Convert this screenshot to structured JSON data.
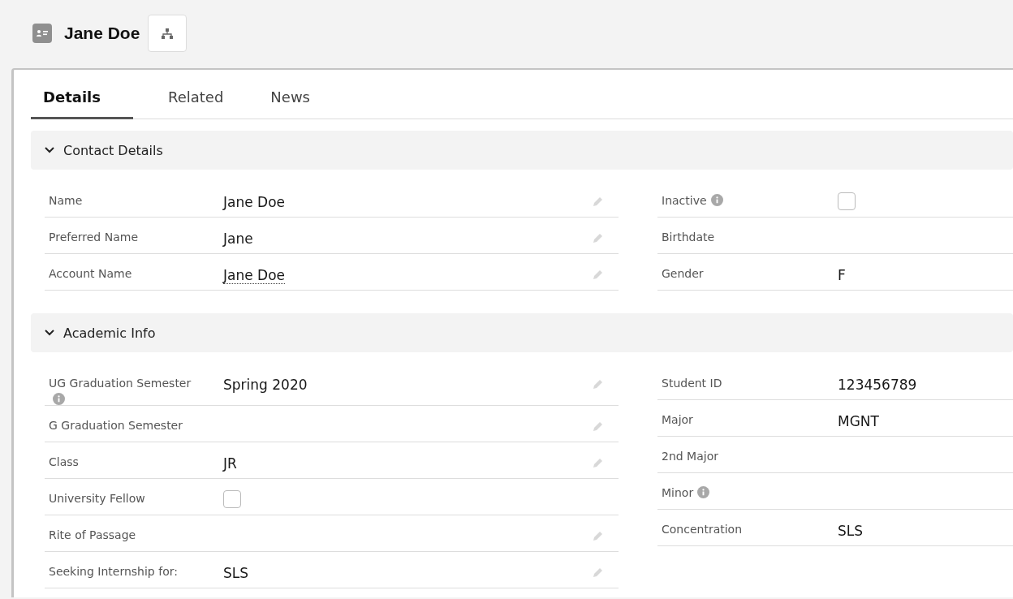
{
  "header": {
    "title": "Jane Doe"
  },
  "tabs": [
    {
      "label": "Details",
      "selected": true
    },
    {
      "label": "Related",
      "selected": false
    },
    {
      "label": "News",
      "selected": false
    }
  ],
  "sections": [
    {
      "title": "Contact Details",
      "expanded": true,
      "left": [
        {
          "label": "Name",
          "kind": "text",
          "value": "Jane Doe",
          "editable": true
        },
        {
          "label": "Preferred Name",
          "kind": "text",
          "value": "Jane",
          "editable": true
        },
        {
          "label": "Account Name",
          "kind": "link",
          "value": "Jane Doe",
          "editable": true
        }
      ],
      "right": [
        {
          "label": "Inactive",
          "info": true,
          "kind": "checkbox",
          "checked": false
        },
        {
          "label": "Birthdate",
          "kind": "text"
        },
        {
          "label": "Gender",
          "kind": "text",
          "value": "F"
        }
      ]
    },
    {
      "title": "Academic Info",
      "expanded": true,
      "left": [
        {
          "label": "UG Graduation Semester",
          "info": true,
          "kind": "text",
          "value": "Spring 2020",
          "editable": true
        },
        {
          "label": "G Graduation Semester",
          "kind": "text",
          "editable": true
        },
        {
          "label": "Class",
          "kind": "text",
          "value": "JR",
          "editable": true
        },
        {
          "label": "University Fellow",
          "kind": "checkbox",
          "checked": false
        },
        {
          "label": "Rite of Passage",
          "kind": "text",
          "editable": true
        },
        {
          "label": "Seeking Internship for:",
          "kind": "text",
          "value": "SLS",
          "editable": true
        }
      ],
      "right": [
        {
          "label": "Student ID",
          "kind": "text",
          "value": "123456789"
        },
        {
          "label": "Major",
          "kind": "text",
          "value": "MGNT"
        },
        {
          "label": "2nd Major",
          "kind": "text"
        },
        {
          "label": "Minor",
          "info": true,
          "kind": "text"
        },
        {
          "label": "Concentration",
          "kind": "text",
          "value": "SLS"
        }
      ]
    }
  ]
}
